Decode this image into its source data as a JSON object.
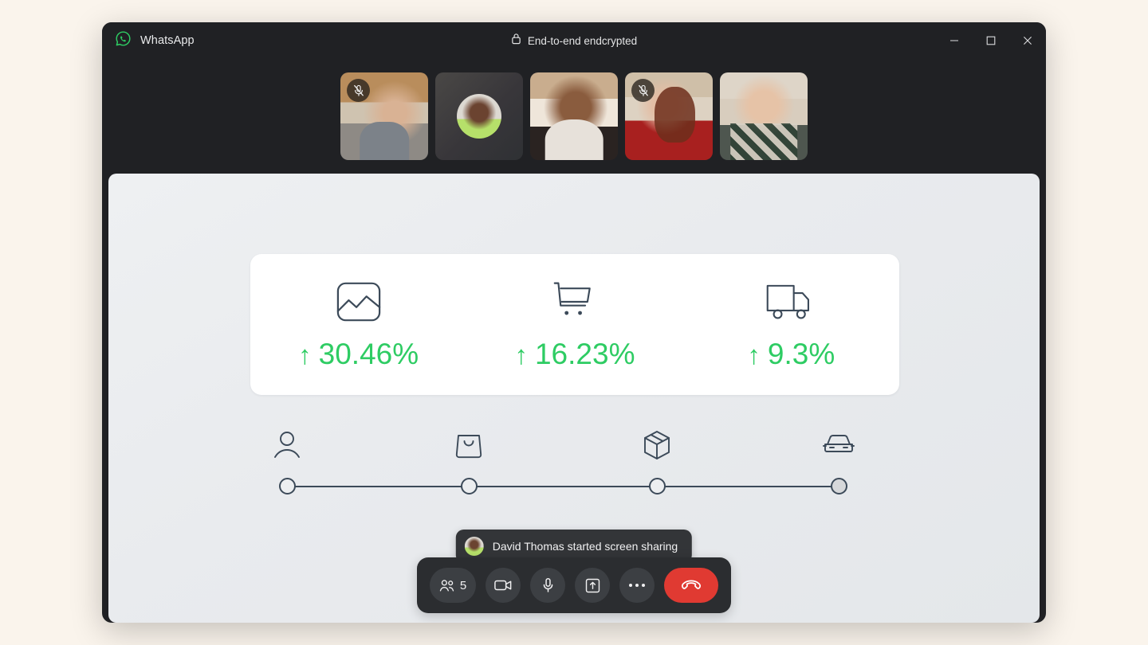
{
  "window": {
    "app_name": "WhatsApp",
    "app_icon": "whatsapp-logo-icon",
    "encryption_label": "End-to-end endcrypted",
    "encryption_icon": "lock-icon",
    "controls": {
      "minimize": "minimize-icon",
      "maximize": "maximize-icon",
      "close": "close-icon"
    }
  },
  "participants": [
    {
      "id": "p1",
      "camera_on": true,
      "muted": true,
      "mute_icon": "mic-off-icon"
    },
    {
      "id": "p2",
      "camera_on": false,
      "muted": false,
      "avatar": "david-thomas-avatar"
    },
    {
      "id": "p3",
      "camera_on": true,
      "muted": false
    },
    {
      "id": "p4",
      "camera_on": true,
      "muted": true,
      "mute_icon": "mic-off-icon"
    },
    {
      "id": "p5",
      "camera_on": true,
      "muted": false
    }
  ],
  "shared_screen": {
    "metrics": [
      {
        "icon": "chart-image-icon",
        "arrow": "↑",
        "value": "30.46%"
      },
      {
        "icon": "shopping-cart-icon",
        "arrow": "↑",
        "value": "16.23%"
      },
      {
        "icon": "delivery-truck-icon",
        "arrow": "↑",
        "value": "9.3%"
      }
    ],
    "timeline": {
      "steps": [
        {
          "icon": "person-icon",
          "position_pct": 0,
          "state": "empty"
        },
        {
          "icon": "shopping-bag-icon",
          "position_pct": 33.3,
          "state": "empty"
        },
        {
          "icon": "package-box-icon",
          "position_pct": 66.6,
          "state": "empty"
        },
        {
          "icon": "car-icon",
          "position_pct": 100,
          "state": "filled"
        }
      ]
    },
    "accent_color": "#2ecc63",
    "icon_color": "#3c4a59"
  },
  "toast": {
    "avatar": "david-thomas-avatar",
    "message": "David Thomas started screen sharing"
  },
  "call_controls": {
    "participants_count": "5",
    "participants_icon": "people-icon",
    "camera_icon": "video-camera-icon",
    "microphone_icon": "microphone-icon",
    "share_screen_icon": "share-screen-icon",
    "more_icon": "more-options-icon",
    "end_call_icon": "end-call-icon",
    "end_call_color": "#e03a32"
  }
}
